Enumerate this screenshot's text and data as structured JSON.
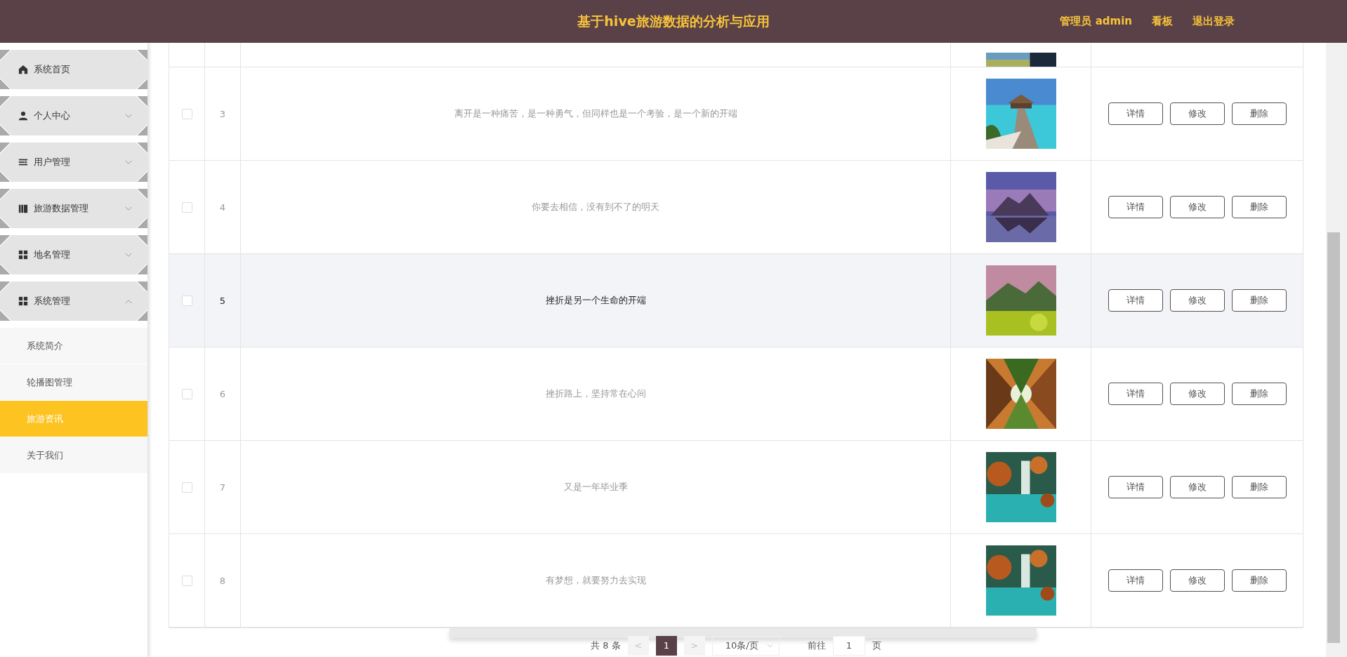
{
  "header": {
    "title": "基于hive旅游数据的分析与应用",
    "links": [
      "管理员 admin",
      "看板",
      "退出登录"
    ]
  },
  "sidebar": {
    "items": [
      {
        "label": "系统首页"
      },
      {
        "label": "个人中心",
        "expanded": false
      },
      {
        "label": "用户管理",
        "expanded": false
      },
      {
        "label": "旅游数据管理",
        "expanded": false
      },
      {
        "label": "地名管理",
        "expanded": false
      },
      {
        "label": "系统管理",
        "expanded": true,
        "children": [
          {
            "label": "系统简介",
            "selected": false
          },
          {
            "label": "轮播图管理",
            "selected": false
          },
          {
            "label": "旅游资讯",
            "selected": true
          },
          {
            "label": "关于我们",
            "selected": false
          }
        ]
      }
    ]
  },
  "table": {
    "rows": [
      {
        "index": "3",
        "text": "离开是一种痛苦，是一种勇气，但同样也是一个考验，是一个新的开端",
        "checked": false,
        "hovered": false,
        "actions": [
          "详情",
          "修改",
          "删除"
        ]
      },
      {
        "index": "4",
        "text": "你要去相信，没有到不了的明天",
        "checked": false,
        "hovered": false,
        "actions": [
          "详情",
          "修改",
          "删除"
        ]
      },
      {
        "index": "5",
        "text": "挫折是另一个生命的开端",
        "checked": false,
        "hovered": true,
        "actions": [
          "详情",
          "修改",
          "删除"
        ]
      },
      {
        "index": "6",
        "text": "挫折路上，坚持常在心间",
        "checked": false,
        "hovered": false,
        "actions": [
          "详情",
          "修改",
          "删除"
        ]
      },
      {
        "index": "7",
        "text": "又是一年毕业季",
        "checked": false,
        "hovered": false,
        "actions": [
          "详情",
          "修改",
          "删除"
        ]
      },
      {
        "index": "8",
        "text": "有梦想，就要努力去实现",
        "checked": false,
        "hovered": false,
        "actions": [
          "详情",
          "修改",
          "删除"
        ]
      }
    ]
  },
  "pagination": {
    "total": "共 8 条",
    "prev": "<",
    "pages": [
      {
        "label": "1",
        "selected": true
      }
    ],
    "next": ">",
    "page_size": "10条/页",
    "goto_label": "前往",
    "goto_value": "1",
    "goto_suffix": "页"
  }
}
